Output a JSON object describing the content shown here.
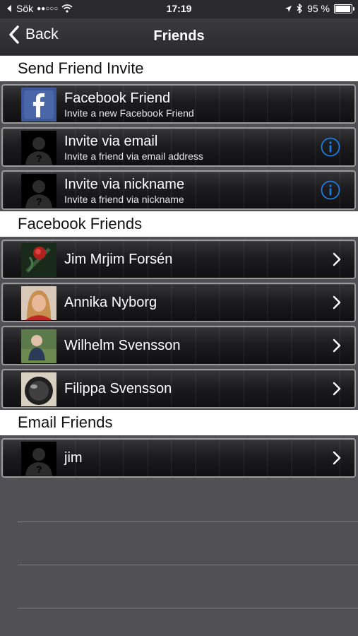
{
  "status_bar": {
    "back_app_label": "Sök",
    "signal_icon": "signal-dots-icon",
    "wifi_icon": "wifi-icon",
    "time": "17:19",
    "location_icon": "location-arrow-icon",
    "bluetooth_icon": "bluetooth-icon",
    "battery_percent": "95 %",
    "battery_level": 0.95
  },
  "nav": {
    "back_label": "Back",
    "title": "Friends"
  },
  "sections": {
    "invite": {
      "header": "Send Friend Invite",
      "items": [
        {
          "title": "Facebook Friend",
          "subtitle": "Invite a new Facebook Friend",
          "icon": "facebook-icon"
        },
        {
          "title": "Invite via email",
          "subtitle": "Invite a friend via email address",
          "icon": "info-icon"
        },
        {
          "title": "Invite via nickname",
          "subtitle": "Invite a friend via nickname",
          "icon": "info-icon"
        }
      ]
    },
    "facebook": {
      "header": "Facebook Friends",
      "items": [
        {
          "name": "Jim Mrjim Forsén"
        },
        {
          "name": "Annika Nyborg"
        },
        {
          "name": "Wilhelm Svensson"
        },
        {
          "name": "Filippa Svensson"
        }
      ]
    },
    "email": {
      "header": "Email Friends",
      "items": [
        {
          "name": "jim"
        }
      ]
    }
  },
  "colors": {
    "accent_blue": "#1e7be0",
    "section_header_bg": "#ffffff",
    "row_border": "#9a9a9a",
    "background": "#505055"
  }
}
